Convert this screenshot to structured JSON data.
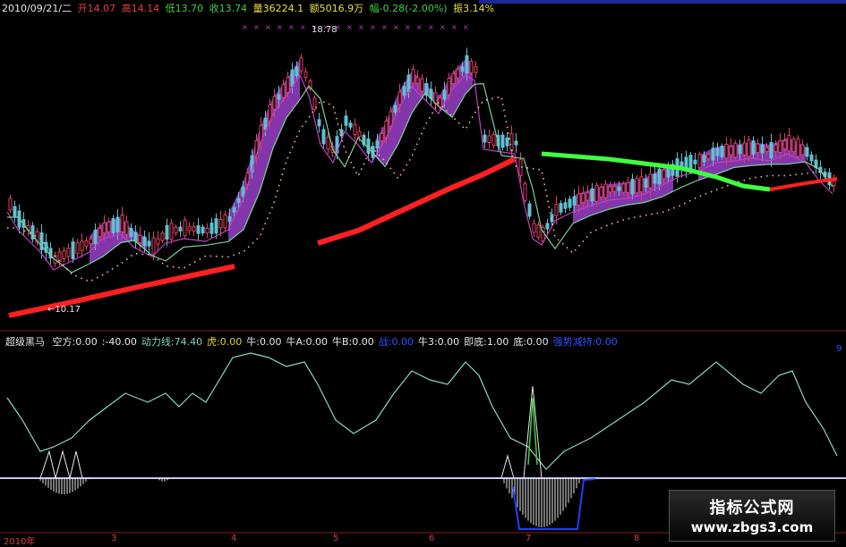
{
  "header": {
    "date": "2010/09/21/二",
    "open_label": "开",
    "open_value": "14.07",
    "high_label": "高",
    "high_value": "14.14",
    "low_label": "低",
    "low_value": "13.70",
    "close_label": "收",
    "close_value": "13.74",
    "volume_label": "量",
    "volume_value": "36224.1",
    "amount_label": "额",
    "amount_value": "5016.9万",
    "change_label": "幅",
    "change_value": "-0.28(-2.00%)",
    "turnover_label": "振",
    "turnover_value": "3.14%"
  },
  "price_chart": {
    "high_marker": "18.78",
    "low_marker": "←10.17"
  },
  "indicator_header": {
    "name": "超级黑马",
    "items": [
      {
        "text": "空方:0.00",
        "color": "#e8e8e8"
      },
      {
        "text": ":-40.00",
        "color": "#e8e8e8"
      },
      {
        "text": "动力线:74.40",
        "color": "#7fd4c0"
      },
      {
        "text": "虎:0.00",
        "color": "#e0d040"
      },
      {
        "text": "牛:0.00",
        "color": "#e8e8e8"
      },
      {
        "text": "牛A:0.00",
        "color": "#e8e8e8"
      },
      {
        "text": "牛B:0.00",
        "color": "#e8e8e8"
      },
      {
        "text": "战:0.00",
        "color": "#3050ff"
      },
      {
        "text": "牛3:0.00",
        "color": "#e8e8e8"
      },
      {
        "text": "即底:1.00",
        "color": "#e8e8e8"
      },
      {
        "text": "底:0.00",
        "color": "#e8e8e8"
      },
      {
        "text": "强势减持:0.00",
        "color": "#3050ff"
      }
    ],
    "scale_label": "9"
  },
  "x_axis": {
    "labels": [
      "2010年",
      "3",
      "4",
      "5",
      "6",
      "7",
      "8"
    ]
  },
  "watermark": {
    "line1": "指标公式网",
    "line2": "www.zbgs3.com"
  },
  "colors": {
    "up": "#e04060",
    "down": "#60c0d0",
    "cloud": "#9a40c8",
    "long_ma_bear": "#ff2020",
    "long_ma_bull": "#40ff40",
    "power_line": "#8ad8c0"
  }
}
